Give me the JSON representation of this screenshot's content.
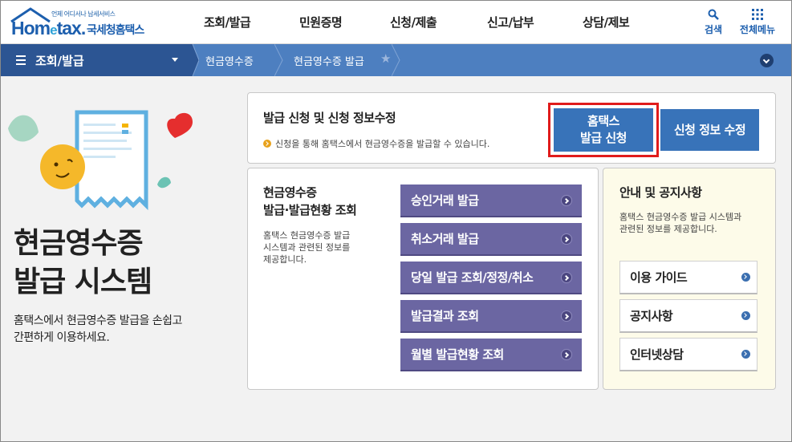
{
  "header": {
    "logo_sub": "언제 어디서나 납세서비스",
    "logo_main_a": "Hom",
    "logo_main_e": "e",
    "logo_main_b": "tax.",
    "logo_kr": "국세청홈택스",
    "nav": [
      "조회/발급",
      "민원증명",
      "신청/제출",
      "신고/납부",
      "상담/제보"
    ],
    "search_label": "검색",
    "allmenu_label": "전체메뉴"
  },
  "subnav": {
    "menu_label": "조회/발급",
    "crumbs": [
      "현금영수증",
      "현금영수증 발급"
    ]
  },
  "intro": {
    "title_line1": "현금영수증",
    "title_line2": "발급 시스템",
    "desc_line1": "홈택스에서 현금영수증 발급을 손쉽고",
    "desc_line2": "간편하게 이용하세요."
  },
  "issue_box": {
    "title": "발급 신청 및 신청 정보수정",
    "note": "신청을 통해 홈택스에서 현금영수증을 발급할 수 있습니다.",
    "apply_line1": "홈택스",
    "apply_line2": "발급 신청",
    "modify_label": "신청 정보 수정"
  },
  "status_box": {
    "title_line1": "현금영수증",
    "title_line2": "발급·발급현황 조회",
    "desc_line1": "홈택스 현금영수증 발급",
    "desc_line2": "시스템과 관련된 정보를",
    "desc_line3": "제공합니다.",
    "buttons": [
      "승인거래 발급",
      "취소거래 발급",
      "당일 발급 조회/정정/취소",
      "발급결과 조회",
      "월별 발급현황 조회"
    ]
  },
  "notice_box": {
    "title": "안내 및 공지사항",
    "desc_line1": "홈택스 현금영수증 발급 시스템과",
    "desc_line2": "관련된 정보를 제공합니다.",
    "buttons": [
      "이용 가이드",
      "공지사항",
      "인터넷상담"
    ]
  },
  "colors": {
    "brand_blue": "#1d5fae",
    "subnav_blue": "#4d7fc0",
    "subnav_dark": "#2c5593",
    "button_blue": "#3873b9",
    "button_purple": "#6b66a2",
    "highlight_red": "#e01b1b",
    "notice_bg": "#fdfbe9"
  }
}
